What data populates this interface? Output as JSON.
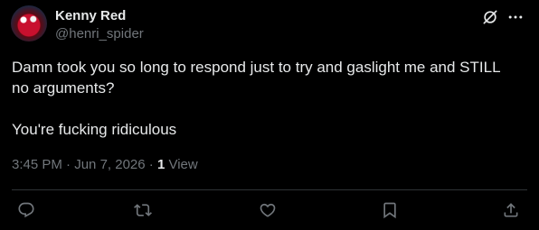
{
  "author": {
    "name": "Kenny Red",
    "handle": "@henri_spider"
  },
  "tweet": {
    "text": "Damn took you so long to respond just to try and gaslight me and STILL\nno arguments?\n\nYou're fucking ridiculous",
    "time": "3:45 PM",
    "date": "Jun 7, 2026",
    "separator": "·",
    "views_count": "1",
    "views_label": "View"
  },
  "icons": {
    "grok": "grok-icon",
    "more": "more-icon",
    "reply": "reply-icon",
    "retweet": "retweet-icon",
    "like": "heart-icon",
    "bookmark": "bookmark-icon",
    "share": "share-icon"
  },
  "colors": {
    "background": "#000000",
    "text": "#e7e9ea",
    "secondary": "#71767b",
    "divider": "#2f3336"
  }
}
